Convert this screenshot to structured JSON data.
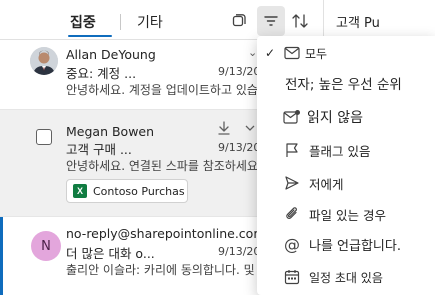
{
  "tabs": {
    "focused": "집중",
    "other": "기타"
  },
  "right_pane": {
    "title": "고객 Pu"
  },
  "mails": [
    {
      "sender": "Allan DeYoung",
      "subject": "중요: 계정 ...",
      "date": "9/13/20",
      "preview": "안녕하세요. 계정을 업데이트하고 있습니다."
    },
    {
      "sender": "Megan Bowen",
      "subject": "고객 구매 ...",
      "date": "9/13/20",
      "preview": "안녕하세요. 연결된 스파를 참조하세요.",
      "attachment": "Contoso Purchas"
    },
    {
      "sender": "no-reply@sharepointonline.com",
      "subject": "더 많은 대화 o...",
      "date": "9/13/20",
      "preview": "출리안 이슬라: 카리에 동의합니다. 및",
      "avatar_initial": "N"
    }
  ],
  "filter_menu": {
    "items": [
      {
        "label": "모두",
        "icon": "mail-icon",
        "checked": true
      },
      {
        "label": "전자; 높은 우선 순위",
        "icon": "",
        "checked": false
      },
      {
        "label": "읽지 않음",
        "icon": "mail-unread-icon",
        "checked": false
      },
      {
        "label": "플래그 있음",
        "icon": "flag-icon",
        "checked": false
      },
      {
        "label": "저에게",
        "icon": "send-icon",
        "checked": false
      },
      {
        "label": "파일 있는 경우",
        "icon": "paperclip-icon",
        "checked": false
      },
      {
        "label": "나를 언급합니다.",
        "icon": "mention-icon",
        "checked": false
      },
      {
        "label": "일정 초대 있음",
        "icon": "calendar-icon",
        "checked": false
      }
    ]
  },
  "colors": {
    "accent": "#0f6cbd",
    "selected_row": "#f0f0f0",
    "excel_green": "#107c41",
    "avatar_pink": "#e3a6dc"
  }
}
